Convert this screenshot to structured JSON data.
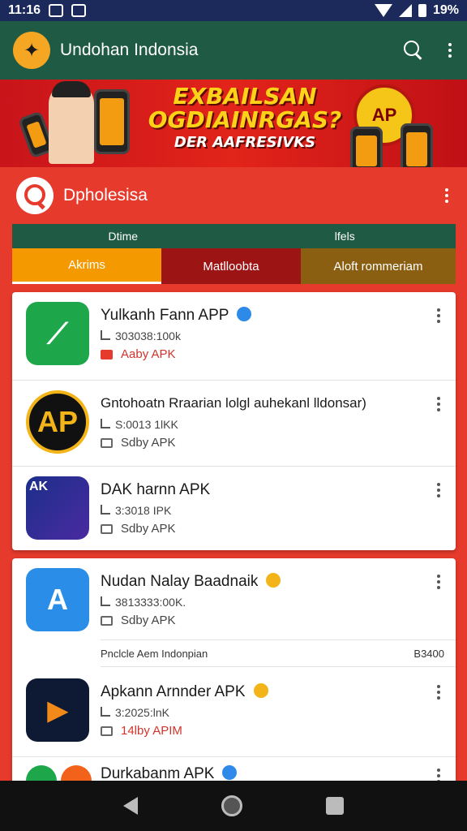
{
  "statusbar": {
    "time": "11:16",
    "battery": "19%"
  },
  "appbar": {
    "title": "Undohan Indonsia"
  },
  "banner": {
    "line1": "EXBAILSAN",
    "line2": "OGDIAINRGAS?",
    "line3": "DER AAFRESIVKS",
    "seal": "AP"
  },
  "search": {
    "text": "Dpholesisa"
  },
  "tabs_top": [
    "Dtime",
    "lfels"
  ],
  "tabs_bottom": [
    "Akrims",
    "Matlloobta",
    "Aloft rommeriam"
  ],
  "colors": {
    "green": "#1f5a44",
    "red": "#e53a2c",
    "verified_blue": "#2d8ae8",
    "verified_gold": "#f2b418"
  },
  "apps": [
    {
      "title": "Yulkanh Fann APP",
      "meta": "303038:100k",
      "sub": "Aaby APK",
      "icon_text": "",
      "verified": "blue"
    },
    {
      "title": "Gntohoatn Rraarian lolgl auhekanl lldonsar)",
      "meta": "S:0013 1lKK",
      "sub": "Sdby APK",
      "icon_text": "AP",
      "verified": ""
    },
    {
      "title": "DAK harnn APK",
      "meta": "3:3018 IPK",
      "sub": "Sdby APK",
      "icon_text": "AK",
      "verified": ""
    },
    {
      "title": "Nudan Nalay Baadnaik",
      "meta": "3813333:00K.",
      "sub": "Sdby APK",
      "icon_text": "",
      "verified": "gold"
    },
    {
      "title": "Apkann Arnnder APK",
      "meta": "3:2025:lnK",
      "sub": "14lby APIM",
      "icon_text": "",
      "verified": "gold"
    },
    {
      "title": "Durkabanm APK",
      "meta": "",
      "sub": "",
      "icon_text": "",
      "verified": "blue"
    }
  ],
  "card2_footer": {
    "left": "Pnclcle Aem Indonpian",
    "right": "B3400"
  }
}
